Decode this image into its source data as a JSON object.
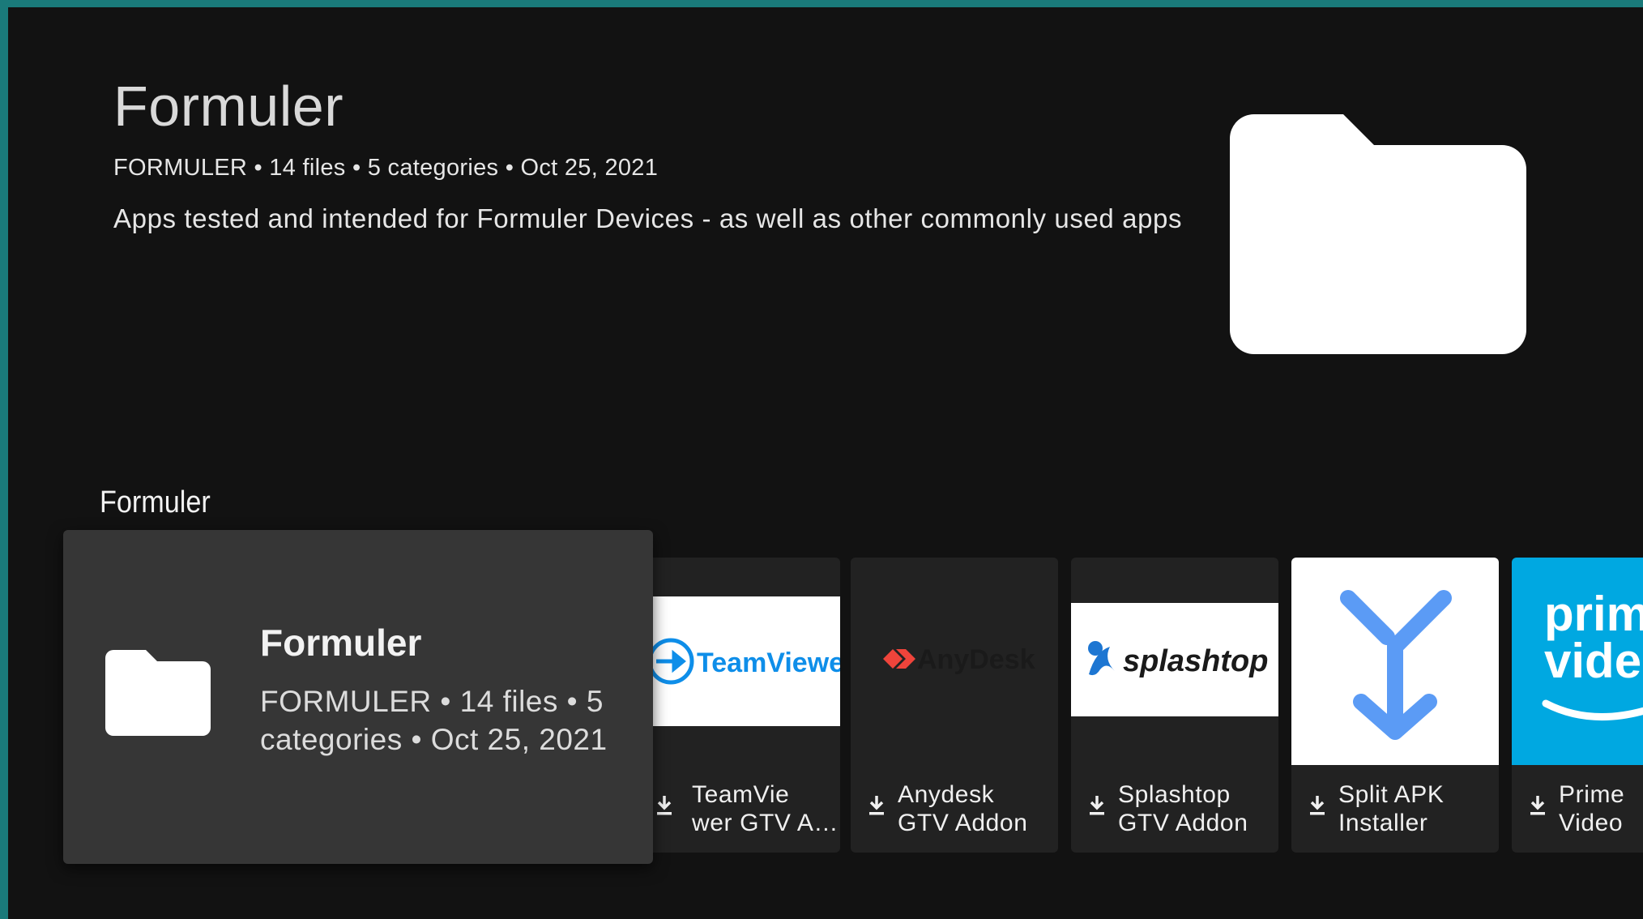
{
  "header": {
    "title": "Formuler",
    "meta": "FORMULER • 14 files • 5 categories • Oct 25, 2021",
    "description": "Apps tested and intended for  Formuler Devices - as well as other commonly used apps",
    "folder_icon": "folder-icon"
  },
  "row": {
    "title": "Formuler",
    "focused_card": {
      "title": "Formuler",
      "meta": "FORMULER • 14 files • 5 categories • Oct 25, 2021",
      "icon": "folder-icon"
    },
    "items": [
      {
        "label_line1": "TeamVie",
        "label_line2": "wer GTV A…",
        "logo_text": "TeamViewer",
        "icon": "download-icon"
      },
      {
        "label_line1": "Anydesk",
        "label_line2": "GTV Addon",
        "logo_text": "AnyDesk",
        "icon": "download-icon"
      },
      {
        "label_line1": "Splashtop",
        "label_line2": "GTV Addon",
        "logo_text": "splashtop",
        "icon": "download-icon"
      },
      {
        "label_line1": "Split APK",
        "label_line2": "Installer",
        "logo_text": "",
        "icon": "download-icon"
      },
      {
        "label_line1": "Prime",
        "label_line2": "Video",
        "logo_text_1": "prim",
        "logo_text_2": "vide",
        "icon": "download-icon"
      }
    ]
  },
  "colors": {
    "background": "#121212",
    "card": "#222222",
    "focused_card": "#363636",
    "teamviewer_blue": "#0e8ee9",
    "anydesk_red": "#ef443b",
    "splashtop_blue": "#1d76d2",
    "splitapk_blue": "#5b9bf5",
    "prime_blue": "#00a8e1",
    "frame": "#1a7a7a"
  }
}
